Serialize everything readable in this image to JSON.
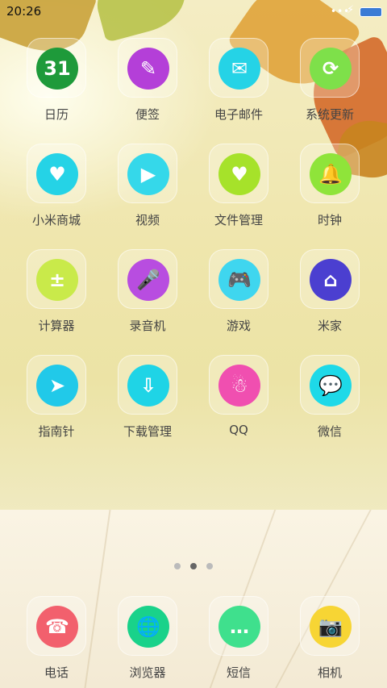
{
  "status_bar": {
    "time": "20:26",
    "signal": "•••",
    "charging": "⚡"
  },
  "apps": [
    {
      "label": "日历",
      "icon": "calendar-icon",
      "color": "#1e9a3a",
      "glyph": "31"
    },
    {
      "label": "便签",
      "icon": "notes-icon",
      "color": "#b43fd8",
      "glyph": "✎"
    },
    {
      "label": "电子邮件",
      "icon": "mail-icon",
      "color": "#25d3e6",
      "glyph": "✉"
    },
    {
      "label": "系统更新",
      "icon": "update-icon",
      "color": "#7ee04a",
      "glyph": "⟳"
    },
    {
      "label": "小米商城",
      "icon": "shop-bag-icon",
      "color": "#25d3e6",
      "glyph": "♥"
    },
    {
      "label": "视频",
      "icon": "video-play-icon",
      "color": "#35d8ea",
      "glyph": "▶"
    },
    {
      "label": "文件管理",
      "icon": "folder-icon",
      "color": "#a6e22a",
      "glyph": "♥"
    },
    {
      "label": "时钟",
      "icon": "bell-icon",
      "color": "#8fe43a",
      "glyph": "🔔"
    },
    {
      "label": "计算器",
      "icon": "calculator-icon",
      "color": "#c9ea4a",
      "glyph": "±"
    },
    {
      "label": "录音机",
      "icon": "microphone-icon",
      "color": "#b84de0",
      "glyph": "🎤"
    },
    {
      "label": "游戏",
      "icon": "gamepad-icon",
      "color": "#3fd6ef",
      "glyph": "🎮"
    },
    {
      "label": "米家",
      "icon": "home-icon",
      "color": "#4b3fd0",
      "glyph": "⌂"
    },
    {
      "label": "指南针",
      "icon": "compass-icon",
      "color": "#21c9e9",
      "glyph": "➤"
    },
    {
      "label": "下载管理",
      "icon": "download-icon",
      "color": "#1fd4e6",
      "glyph": "⇩"
    },
    {
      "label": "QQ",
      "icon": "qq-penguin-icon",
      "color": "#f04fb0",
      "glyph": "☃"
    },
    {
      "label": "微信",
      "icon": "wechat-icon",
      "color": "#1ed9e8",
      "glyph": "💬"
    }
  ],
  "dock": [
    {
      "label": "电话",
      "icon": "phone-icon",
      "color": "#f2606d",
      "glyph": "☎"
    },
    {
      "label": "浏览器",
      "icon": "browser-globe-icon",
      "color": "#19d28a",
      "glyph": "🌐"
    },
    {
      "label": "短信",
      "icon": "message-icon",
      "color": "#3fe08d",
      "glyph": "…"
    },
    {
      "label": "相机",
      "icon": "camera-icon",
      "color": "#f7d534",
      "glyph": "📷"
    }
  ],
  "pager": {
    "pages": 3,
    "current": 2
  }
}
